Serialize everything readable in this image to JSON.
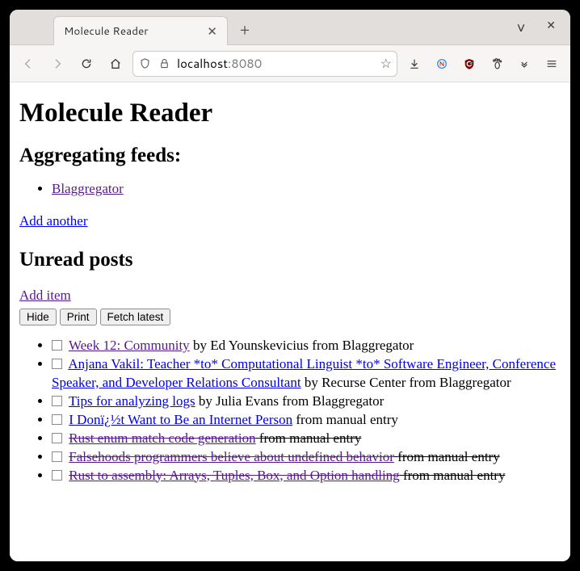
{
  "browser": {
    "tab_title": "Molecule Reader",
    "url": {
      "scheme": "",
      "host": "localhost",
      "port": ":8080"
    }
  },
  "page": {
    "title": "Molecule Reader",
    "feeds_heading": "Aggregating feeds:",
    "feeds": [
      {
        "name": "Blaggregator",
        "visited": true
      }
    ],
    "add_feed_label": "Add another",
    "unread_heading": "Unread posts",
    "add_item_label": "Add item",
    "buttons": {
      "hide": "Hide",
      "print": "Print",
      "fetch": "Fetch latest"
    },
    "posts": [
      {
        "title": "Week 12: Community",
        "author": "Ed Younskevicius",
        "source": "Blaggregator",
        "visited": true,
        "struck": false
      },
      {
        "title": "Anjana Vakil: Teacher *to* Computational Linguist *to* Software Engineer, Conference Speaker, and Developer Relations Consultant",
        "author": "Recurse Center",
        "source": "Blaggregator",
        "visited": false,
        "struck": false
      },
      {
        "title": "Tips for analyzing logs",
        "author": "Julia Evans",
        "source": "Blaggregator",
        "visited": false,
        "struck": false
      },
      {
        "title": "I Donï¿½t Want to Be an Internet Person",
        "author": "",
        "source": "manual entry",
        "visited": false,
        "struck": false
      },
      {
        "title": "Rust enum match code generation",
        "author": "",
        "source": "manual entry",
        "visited": true,
        "struck": true
      },
      {
        "title": "Falsehoods programmers believe about undefined behavior",
        "author": "",
        "source": "manual entry",
        "visited": true,
        "struck": true
      },
      {
        "title": "Rust to assembly: Arrays, Tuples, Box, and Option handling",
        "author": "",
        "source": "manual entry",
        "visited": true,
        "struck": true
      }
    ]
  }
}
